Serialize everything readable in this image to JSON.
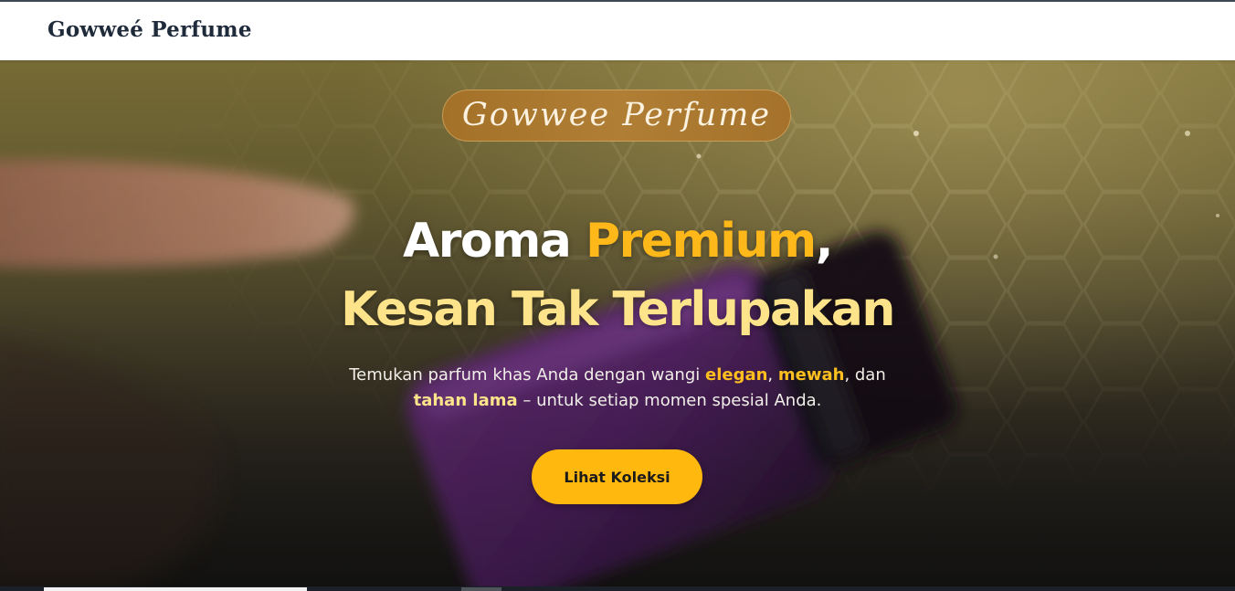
{
  "navbar": {
    "brand": "Gowweé Perfume"
  },
  "hero": {
    "badge": "Gowwee Perfume",
    "headline_line1": {
      "part1": "Aroma ",
      "highlight": "Premium",
      "part2": ","
    },
    "headline_line2": "Kesan Tak Terlupakan",
    "subtitle": {
      "line1_text": "Temukan parfum khas Anda dengan wangi ",
      "highlight_elegan": "elegan",
      "sep_comma": ", ",
      "highlight_mewah": "mewah",
      "line1_end": ", dan",
      "highlight_tahan": "tahan lama",
      "line2_text": " – untuk setiap momen spesial Anda."
    },
    "cta_label": "Lihat Koleksi",
    "background_image": "blurred purple perfume bottle held by fingers on gold hexagon surface"
  },
  "colors": {
    "accent_gold": "#ffb80d",
    "headline_light_gold": "#fde38a",
    "badge_bronze": "#a47129",
    "brand_text": "#1f2a3b"
  }
}
